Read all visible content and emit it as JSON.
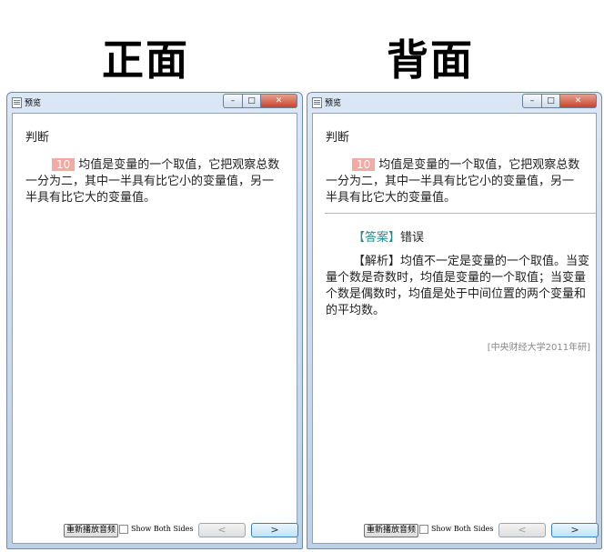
{
  "headings": {
    "front": "正面",
    "back": "背面"
  },
  "window": {
    "title": "预览",
    "controls": {
      "minimize": "–",
      "maximize": "□",
      "close": "✕"
    }
  },
  "card": {
    "type_label": "判断",
    "number": "10",
    "question": "均值是变量的一个取值，它把观察总数一分为二，其中一半具有比它小的变量值，另一半具有比它大的变量值。",
    "answer_tag": "【答案】",
    "answer": "错误",
    "analysis_tag": "【解析】",
    "analysis": "均值不一定是变量的一个取值。当变量个数是奇数时，均值是变量的一个取值；当变量个数是偶数时，均值是处于中间位置的两个变量和的平均数。",
    "source": "[中央财经大学2011年研]"
  },
  "footer": {
    "replay_label": "重新播放音频",
    "show_both_label": "Show Both Sides",
    "prev_label": "<",
    "next_label": ">"
  },
  "icons": {
    "app": "preview-app-icon",
    "checkbox": "checkbox-unchecked"
  }
}
